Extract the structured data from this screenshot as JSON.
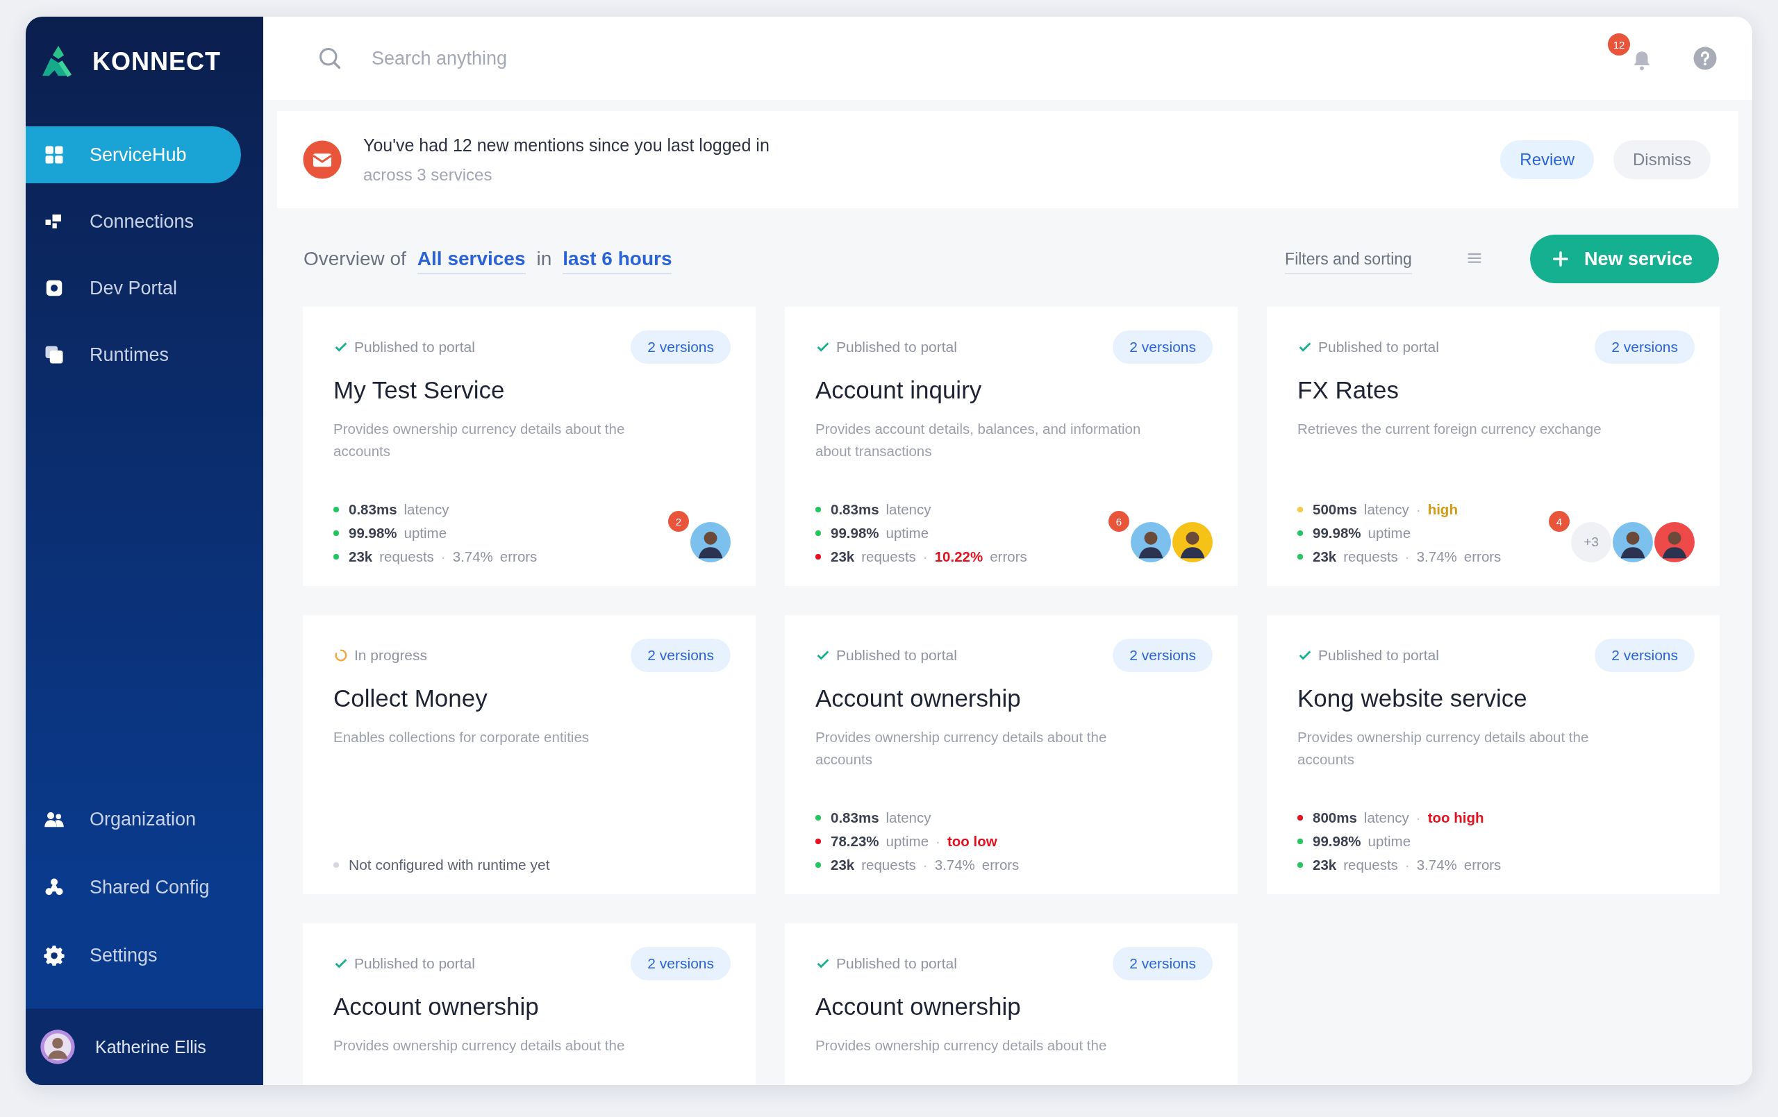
{
  "brand": {
    "name": "KONNECT"
  },
  "sidebar": {
    "items": [
      {
        "label": "ServiceHub",
        "selected": true
      },
      {
        "label": "Connections",
        "selected": false
      },
      {
        "label": "Dev Portal",
        "selected": false
      },
      {
        "label": "Runtimes",
        "selected": false
      }
    ],
    "bottom_items": [
      {
        "label": "Organization",
        "selected": false
      },
      {
        "label": "Shared Config",
        "selected": false
      },
      {
        "label": "Settings",
        "selected": false
      }
    ],
    "user": {
      "name": "Katherine Ellis"
    }
  },
  "search": {
    "placeholder": "Search anything"
  },
  "notifications": {
    "count": "12"
  },
  "banner": {
    "title": "You've had 12 new mentions since you last logged in",
    "subtitle": "across 3 services",
    "buttons": [
      {
        "label": "Review",
        "kind": "primary"
      },
      {
        "label": "Dismiss",
        "kind": "secondary"
      }
    ]
  },
  "overview": {
    "prefix": "Overview of",
    "scope": "All services",
    "joiner": "in",
    "period": "last 6 hours",
    "filters": "Filters and sorting",
    "new_button": "New service"
  },
  "cards": [
    {
      "status": "Published to portal",
      "kind": "published",
      "versions": "2 versions",
      "title": "My Test Service",
      "description": "Provides ownership currency details about the accounts",
      "metrics": [
        {
          "color": "#22c55e",
          "amount": "0.83ms",
          "unit": "latency"
        },
        {
          "color": "#22c55e",
          "amount": "99.98%",
          "unit": "uptime"
        },
        {
          "color": "#22c55e",
          "amount": "23k",
          "unit": "requests",
          "extra": {
            "separator": "·",
            "amount": "3.74%",
            "unit": "errors",
            "alert": false
          }
        }
      ],
      "badge": "2",
      "avatars": [
        {
          "color": "#7cc0ee"
        }
      ]
    },
    {
      "status": "Published to portal",
      "kind": "published",
      "versions": "2 versions",
      "title": "Account inquiry",
      "description": "Provides account details, balances, and information about transactions",
      "metrics": [
        {
          "color": "#22c55e",
          "amount": "0.83ms",
          "unit": "latency"
        },
        {
          "color": "#22c55e",
          "amount": "99.98%",
          "unit": "uptime"
        },
        {
          "color": "#e5101e",
          "amount": "23k",
          "unit": "requests",
          "extra": {
            "separator": "·",
            "amount": "10.22%",
            "unit": "errors",
            "alert": true
          }
        }
      ],
      "badge": "6",
      "avatars": [
        {
          "color": "#7cc0ee"
        },
        {
          "color": "#f7c218"
        }
      ]
    },
    {
      "status": "Published to portal",
      "kind": "published",
      "versions": "2 versions",
      "title": "FX Rates",
      "description": "Retrieves the current foreign currency exchange",
      "metrics": [
        {
          "color": "#f7c948",
          "amount": "500ms",
          "unit": "latency",
          "flag": {
            "separator": "·",
            "text": "high",
            "color": "#d49a16"
          }
        },
        {
          "color": "#22c55e",
          "amount": "99.98%",
          "unit": "uptime"
        },
        {
          "color": "#22c55e",
          "amount": "23k",
          "unit": "requests",
          "extra": {
            "separator": "·",
            "amount": "3.74%",
            "unit": "errors",
            "alert": false
          }
        }
      ],
      "badge": "4",
      "more": "+3",
      "avatars": [
        {
          "color": "#7cc0ee"
        },
        {
          "color": "#ef4a4a"
        }
      ]
    },
    {
      "status": "In progress",
      "kind": "in_progress",
      "versions": "2 versions",
      "title": "Collect Money",
      "description": "Enables collections for corporate entities",
      "note": "Not configured with runtime yet"
    },
    {
      "status": "Published to portal",
      "kind": "published",
      "versions": "2 versions",
      "title": "Account ownership",
      "description": "Provides ownership currency details about the accounts",
      "metrics": [
        {
          "color": "#22c55e",
          "amount": "0.83ms",
          "unit": "latency"
        },
        {
          "color": "#e5101e",
          "amount": "78.23%",
          "unit": "uptime",
          "flag": {
            "separator": "·",
            "text": "too low",
            "color": "#e5101e"
          }
        },
        {
          "color": "#22c55e",
          "amount": "23k",
          "unit": "requests",
          "extra": {
            "separator": "·",
            "amount": "3.74%",
            "unit": "errors",
            "alert": false
          }
        }
      ]
    },
    {
      "status": "Published to portal",
      "kind": "published",
      "versions": "2 versions",
      "title": "Kong website service",
      "description": "Provides ownership currency details about the accounts",
      "metrics": [
        {
          "color": "#e5101e",
          "amount": "800ms",
          "unit": "latency",
          "flag": {
            "separator": "·",
            "text": "too high",
            "color": "#e5101e"
          }
        },
        {
          "color": "#22c55e",
          "amount": "99.98%",
          "unit": "uptime"
        },
        {
          "color": "#22c55e",
          "amount": "23k",
          "unit": "requests",
          "extra": {
            "separator": "·",
            "amount": "3.74%",
            "unit": "errors",
            "alert": false
          }
        }
      ]
    },
    {
      "status": "Published to portal",
      "kind": "published",
      "versions": "2 versions",
      "title": "Account ownership",
      "description": "Provides ownership currency details about the"
    },
    {
      "status": "Published to portal",
      "kind": "published",
      "versions": "2 versions",
      "title": "Account ownership",
      "description": "Provides ownership currency details about the"
    }
  ]
}
